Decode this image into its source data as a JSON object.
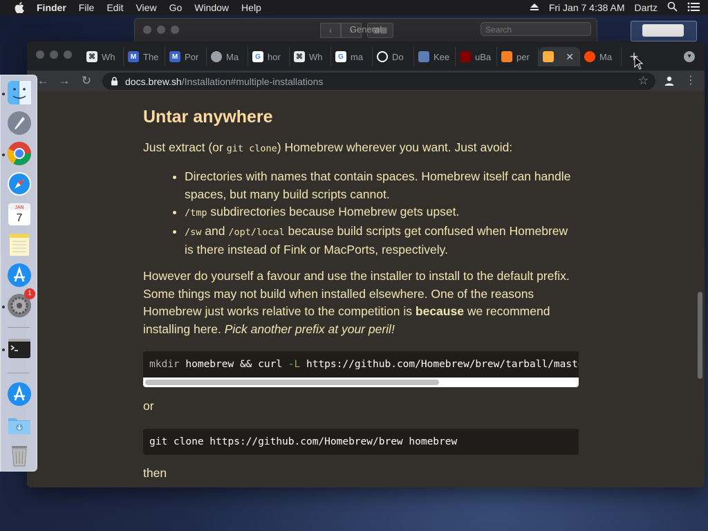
{
  "menubar": {
    "app_name": "Finder",
    "items": [
      "File",
      "Edit",
      "View",
      "Go",
      "Window",
      "Help"
    ],
    "clock": "Fri Jan 7  4:38 AM",
    "user": "Dartz"
  },
  "finder_window": {
    "title": "General",
    "search_placeholder": "Search"
  },
  "chrome": {
    "tabs": [
      {
        "label": "Wh",
        "icon": "bookmark-icon",
        "color": "#e8eaed"
      },
      {
        "label": "The",
        "icon": "mp-icon",
        "color": "#3c64c8"
      },
      {
        "label": "Por",
        "icon": "mp-icon",
        "color": "#3c64c8"
      },
      {
        "label": "Ma",
        "icon": "globe-icon",
        "color": "#9aa0a6"
      },
      {
        "label": "hor",
        "icon": "google-icon",
        "color": "#ffffff"
      },
      {
        "label": "Wh",
        "icon": "bookmark-icon",
        "color": "#e8eaed"
      },
      {
        "label": "ma",
        "icon": "google-icon",
        "color": "#ffffff"
      },
      {
        "label": "Do",
        "icon": "circle-icon",
        "color": "#ffffff"
      },
      {
        "label": "Kee",
        "icon": "eye-icon",
        "color": "#5d7cb6"
      },
      {
        "label": "uBa",
        "icon": "ublock-icon",
        "color": "#800000"
      },
      {
        "label": "per",
        "icon": "stackoverflow-icon",
        "color": "#f48024"
      },
      {
        "label": "",
        "icon": "homebrew-icon",
        "color": "#fbb040",
        "active": true
      },
      {
        "label": "Ma",
        "icon": "reddit-icon",
        "color": "#ff4500"
      }
    ],
    "url_host": "docs.brew.sh",
    "url_path": "/Installation#multiple-installations"
  },
  "article": {
    "heading": "Untar anywhere",
    "intro_pre": "Just extract (or ",
    "intro_code": "git clone",
    "intro_post": ") Homebrew wherever you want. Just avoid:",
    "bullet1": "Directories with names that contain spaces. Homebrew itself can handle spaces, but many build scripts cannot.",
    "bullet2_code": "/tmp",
    "bullet2_text": " subdirectories because Homebrew gets upset.",
    "bullet3_code1": "/sw",
    "bullet3_and": " and ",
    "bullet3_code2": "/opt/local",
    "bullet3_text": " because build scripts get confused when Homebrew is there instead of Fink or MacPorts, respectively.",
    "para_pre": "However do yourself a favour and use the installer to install to the default prefix. Some things may not build when installed elsewhere. One of the reasons Homebrew just works relative to the competition is ",
    "para_bold": "because",
    "para_mid": " we recommend installing here. ",
    "para_italic": "Pick another prefix at your peril!",
    "code1_cmd": "mkdir",
    "code1_a": " homebrew && curl ",
    "code1_flag": "-L",
    "code1_b": " https://github.com/Homebrew/brew/tarball/maste",
    "or_label": "or",
    "code2": "git clone https://github.com/Homebrew/brew homebrew",
    "then_label": "then"
  },
  "dock": {
    "calendar_month": "JAN",
    "calendar_day": "7",
    "prefs_badge": "1"
  }
}
